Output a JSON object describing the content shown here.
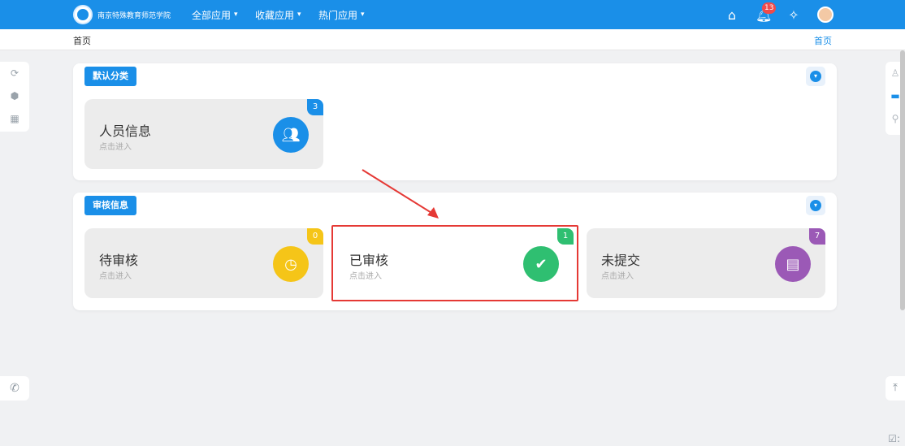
{
  "header": {
    "logo_text": "南京特殊教育师范学院",
    "nav": [
      {
        "label": "全部应用"
      },
      {
        "label": "收藏应用"
      },
      {
        "label": "热门应用"
      }
    ],
    "notifications_count": "13"
  },
  "breadcrumb": {
    "current": "首页",
    "right": "首页"
  },
  "sections": [
    {
      "tag": "默认分类",
      "cards": [
        {
          "title": "人员信息",
          "subtitle": "点击进入",
          "count": "3",
          "icon": "people-icon",
          "color": "#1a8fe8"
        }
      ]
    },
    {
      "tag": "审核信息",
      "cards": [
        {
          "title": "待审核",
          "subtitle": "点击进入",
          "count": "0",
          "icon": "clock-icon",
          "color": "#f5c518"
        },
        {
          "title": "已审核",
          "subtitle": "点击进入",
          "count": "1",
          "icon": "check-circle-icon",
          "color": "#2fbf71"
        },
        {
          "title": "未提交",
          "subtitle": "点击进入",
          "count": "7",
          "icon": "document-icon",
          "color": "#9b59b6"
        }
      ]
    }
  ],
  "colors": {
    "brand": "#1a8fe8",
    "annotation": "#e53935"
  }
}
